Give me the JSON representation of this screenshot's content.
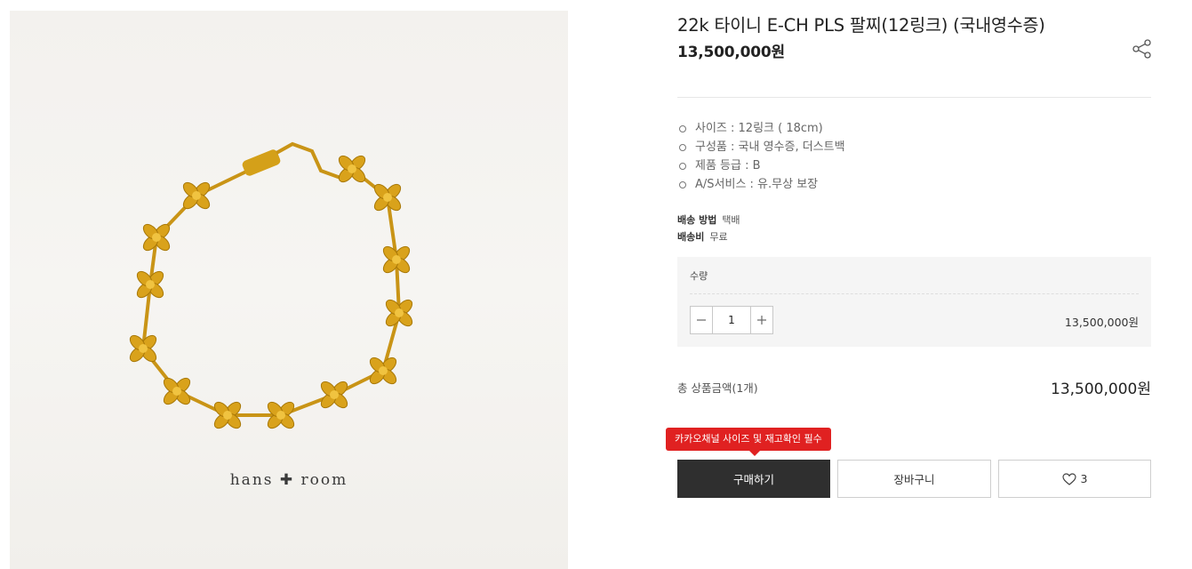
{
  "product": {
    "title": "22k 타이니 E-CH PLS 팔찌(12링크) (국내영수증)",
    "price": "13,500,000원",
    "image": {
      "watermark": "hans ✚ room",
      "icon": "gold-cross-flower-bracelet"
    }
  },
  "options": [
    {
      "label": "사이즈 : 12링크 ( 18cm)"
    },
    {
      "label": "구성품 : 국내 영수증, 더스트백"
    },
    {
      "label": "제품 등급 : B"
    },
    {
      "label": "A/S서비스 :  유.무상 보장"
    }
  ],
  "shipping": {
    "method_label": "배송 방법",
    "method_value": "택배",
    "fee_label": "배송비",
    "fee_value": "무료"
  },
  "quantity": {
    "label": "수량",
    "value": "1",
    "minus_icon": "minus-icon",
    "plus_icon": "plus-icon",
    "line_price": "13,500,000원"
  },
  "total": {
    "label": "총 상품금액(1개)",
    "value": "13,500,000원"
  },
  "actions": {
    "notice": "카카오채널 사이즈 및 재고확인 필수",
    "buy_label": "구매하기",
    "cart_label": "장바구니",
    "wish_count": "3"
  },
  "colors": {
    "buy_button": "#2f2f2f",
    "notice": "#e02121",
    "gold": "#d9a21b"
  }
}
